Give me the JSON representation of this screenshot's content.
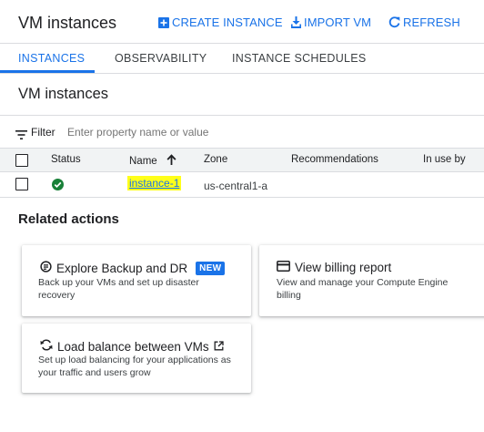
{
  "header": {
    "title": "VM instances",
    "create_label": "CREATE INSTANCE",
    "import_label": "IMPORT VM",
    "refresh_label": "REFRESH"
  },
  "tabs": [
    {
      "label": "INSTANCES",
      "active": true
    },
    {
      "label": "OBSERVABILITY",
      "active": false
    },
    {
      "label": "INSTANCE SCHEDULES",
      "active": false
    }
  ],
  "section_title": "VM instances",
  "filter": {
    "label": "Filter",
    "placeholder": "Enter property name or value"
  },
  "table": {
    "columns": [
      "Status",
      "Name",
      "Zone",
      "Recommendations",
      "In use by"
    ],
    "rows": [
      {
        "status": "running",
        "name": "instance-1",
        "zone": "us-central1-a",
        "recommendations": "",
        "in_use_by": ""
      }
    ]
  },
  "related": {
    "title": "Related actions",
    "cards": [
      {
        "title": "Explore Backup and DR",
        "badge": "NEW",
        "desc": "Back up your VMs and set up disaster recovery",
        "icon": "backup-icon"
      },
      {
        "title": "View billing report",
        "desc": "View and manage your Compute Engine billing",
        "icon": "billing-card-icon"
      },
      {
        "title": "Load balance between VMs",
        "desc": "Set up load balancing for your applications as your traffic and users grow",
        "icon": "load-balance-icon"
      }
    ]
  },
  "colors": {
    "accent": "#1a73e8",
    "status_ok": "#188038",
    "highlight": "#ffff1a"
  }
}
